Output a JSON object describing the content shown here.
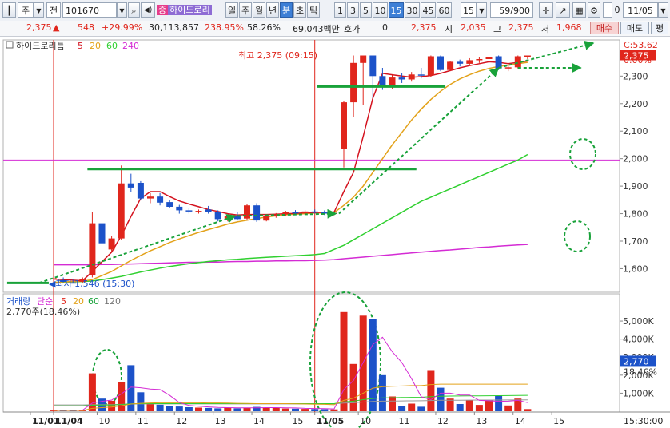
{
  "toolbar": {
    "market": "주",
    "mode": "전",
    "code": "101670",
    "stock_name": "하이드로리",
    "period_tabs": [
      "일",
      "주",
      "월",
      "년",
      "분",
      "초",
      "틱"
    ],
    "active_period": "분",
    "intervals": [
      "1",
      "3",
      "5",
      "10",
      "15",
      "30",
      "45",
      "60"
    ],
    "active_interval": "15",
    "interval_value": "15",
    "count": "59/900",
    "checkbox_label": "0",
    "date": "11/05"
  },
  "quote": {
    "price": "2,375",
    "price_arrow": "▲",
    "change": "548",
    "change_pct": "+29.99%",
    "volume": "30,113,857",
    "volume_ratio": "238.95%",
    "turnover_pct": "58.26%",
    "amount": "69,043백만",
    "quote_label": "호가",
    "quote_value": "0",
    "quote_price": "2,375",
    "open_label": "시",
    "open": "2,035",
    "high_label": "고",
    "high": "2,375",
    "low_label": "저",
    "low": "1,968",
    "buy": "매수",
    "sell": "매도",
    "eval": "평"
  },
  "colors": {
    "up": "#e0261c",
    "down": "#1c52c9",
    "ma5": "#d4131f",
    "ma20": "#e3a21a",
    "ma60": "#30d030",
    "ma240": "#d42bd4",
    "annot": "#19a23a"
  },
  "chart_data": {
    "type": "candlestick",
    "legend": {
      "name": "하이드로리틈",
      "ma": [
        "5",
        "20",
        "60",
        "240"
      ]
    },
    "price_axis": [
      "2,300",
      "2,200",
      "2,100",
      "2,000",
      "1,900",
      "1,800",
      "1,700",
      "1,600"
    ],
    "ylim": [
      1520,
      2420
    ],
    "current_price_label": "2,375",
    "corner_labels": [
      "C:53.62",
      "0.00%"
    ],
    "high_annotation": "최고 2,375 (09:15)",
    "low_annotation": "최저 1,546 (15:30)",
    "reference_line": 1995,
    "time_labels": [
      {
        "label": "11/01",
        "i": -2.4
      },
      {
        "label": "11/04",
        "i": 0
      },
      {
        "label": "10",
        "i": 4.5
      },
      {
        "label": "11",
        "i": 8.5
      },
      {
        "label": "12",
        "i": 12.5
      },
      {
        "label": "13",
        "i": 16.5
      },
      {
        "label": "14",
        "i": 20.5
      },
      {
        "label": "15",
        "i": 24.5
      },
      {
        "label": "11/05",
        "i": 27
      },
      {
        "label": "10",
        "i": 31.5
      },
      {
        "label": "11",
        "i": 35.5
      },
      {
        "label": "12",
        "i": 39.5
      },
      {
        "label": "13",
        "i": 43.5
      },
      {
        "label": "14",
        "i": 47.5
      },
      {
        "label": "15",
        "i": 51.5
      }
    ],
    "candles": [
      {
        "o": 1562,
        "h": 1572,
        "l": 1553,
        "c": 1565
      },
      {
        "o": 1558,
        "h": 1568,
        "l": 1550,
        "c": 1552
      },
      {
        "o": 1550,
        "h": 1560,
        "l": 1546,
        "c": 1548
      },
      {
        "o": 1552,
        "h": 1568,
        "l": 1546,
        "c": 1562
      },
      {
        "o": 1575,
        "h": 1805,
        "l": 1568,
        "c": 1765
      },
      {
        "o": 1765,
        "h": 1790,
        "l": 1675,
        "c": 1692
      },
      {
        "o": 1670,
        "h": 1720,
        "l": 1660,
        "c": 1710
      },
      {
        "o": 1710,
        "h": 1975,
        "l": 1705,
        "c": 1910
      },
      {
        "o": 1910,
        "h": 1945,
        "l": 1878,
        "c": 1895
      },
      {
        "o": 1912,
        "h": 1918,
        "l": 1848,
        "c": 1855
      },
      {
        "o": 1855,
        "h": 1875,
        "l": 1838,
        "c": 1862
      },
      {
        "o": 1862,
        "h": 1875,
        "l": 1830,
        "c": 1840
      },
      {
        "o": 1842,
        "h": 1850,
        "l": 1822,
        "c": 1825
      },
      {
        "o": 1825,
        "h": 1832,
        "l": 1800,
        "c": 1812
      },
      {
        "o": 1812,
        "h": 1820,
        "l": 1800,
        "c": 1808
      },
      {
        "o": 1808,
        "h": 1815,
        "l": 1800,
        "c": 1810
      },
      {
        "o": 1815,
        "h": 1828,
        "l": 1800,
        "c": 1805
      },
      {
        "o": 1805,
        "h": 1812,
        "l": 1772,
        "c": 1780
      },
      {
        "o": 1780,
        "h": 1792,
        "l": 1772,
        "c": 1790
      },
      {
        "o": 1790,
        "h": 1805,
        "l": 1775,
        "c": 1780
      },
      {
        "o": 1782,
        "h": 1835,
        "l": 1775,
        "c": 1830
      },
      {
        "o": 1830,
        "h": 1838,
        "l": 1770,
        "c": 1775
      },
      {
        "o": 1775,
        "h": 1795,
        "l": 1772,
        "c": 1792
      },
      {
        "o": 1792,
        "h": 1802,
        "l": 1785,
        "c": 1797
      },
      {
        "o": 1797,
        "h": 1810,
        "l": 1790,
        "c": 1806
      },
      {
        "o": 1806,
        "h": 1813,
        "l": 1798,
        "c": 1801
      },
      {
        "o": 1801,
        "h": 1813,
        "l": 1795,
        "c": 1808
      },
      {
        "o": 1808,
        "h": 1815,
        "l": 1800,
        "c": 1805
      },
      {
        "o": 1805,
        "h": 1812,
        "l": 1795,
        "c": 1800
      },
      {
        "o": 1800,
        "h": 1810,
        "l": 1794,
        "c": 1803
      },
      {
        "o": 2035,
        "h": 2210,
        "l": 1968,
        "c": 2205
      },
      {
        "o": 2205,
        "h": 2375,
        "l": 2150,
        "c": 2348
      },
      {
        "o": 2348,
        "h": 2375,
        "l": 2195,
        "c": 2375
      },
      {
        "o": 2375,
        "h": 2375,
        "l": 2220,
        "c": 2300
      },
      {
        "o": 2300,
        "h": 2330,
        "l": 2250,
        "c": 2260
      },
      {
        "o": 2260,
        "h": 2305,
        "l": 2255,
        "c": 2295
      },
      {
        "o": 2295,
        "h": 2310,
        "l": 2275,
        "c": 2288
      },
      {
        "o": 2288,
        "h": 2315,
        "l": 2280,
        "c": 2306
      },
      {
        "o": 2306,
        "h": 2330,
        "l": 2292,
        "c": 2302
      },
      {
        "o": 2302,
        "h": 2375,
        "l": 2298,
        "c": 2372
      },
      {
        "o": 2372,
        "h": 2375,
        "l": 2318,
        "c": 2322
      },
      {
        "o": 2322,
        "h": 2355,
        "l": 2318,
        "c": 2352
      },
      {
        "o": 2352,
        "h": 2360,
        "l": 2335,
        "c": 2345
      },
      {
        "o": 2345,
        "h": 2365,
        "l": 2340,
        "c": 2358
      },
      {
        "o": 2358,
        "h": 2370,
        "l": 2348,
        "c": 2362
      },
      {
        "o": 2362,
        "h": 2375,
        "l": 2352,
        "c": 2370
      },
      {
        "o": 2372,
        "h": 2375,
        "l": 2322,
        "c": 2328
      },
      {
        "o": 2328,
        "h": 2340,
        "l": 2318,
        "c": 2332
      },
      {
        "o": 2332,
        "h": 2375,
        "l": 2328,
        "c": 2372
      },
      {
        "o": 2372,
        "h": 2375,
        "l": 2362,
        "c": 2375
      }
    ],
    "ma5": [
      1562,
      1560,
      1558,
      1556,
      1590,
      1625,
      1660,
      1720,
      1790,
      1855,
      1880,
      1880,
      1862,
      1846,
      1835,
      1825,
      1815,
      1808,
      1800,
      1795,
      1797,
      1797,
      1797,
      1798,
      1800,
      1801,
      1803,
      1804,
      1805,
      1805,
      1880,
      1950,
      2080,
      2220,
      2310,
      2305,
      2300,
      2296,
      2298,
      2302,
      2310,
      2320,
      2330,
      2338,
      2345,
      2352,
      2350,
      2345,
      2350,
      2355
    ],
    "ma20": [
      1550,
      1552,
      1553,
      1554,
      1560,
      1575,
      1590,
      1610,
      1630,
      1648,
      1665,
      1680,
      1695,
      1708,
      1720,
      1732,
      1742,
      1752,
      1762,
      1770,
      1776,
      1782,
      1788,
      1792,
      1796,
      1798,
      1800,
      1802,
      1803,
      1804,
      1830,
      1860,
      1900,
      1950,
      2000,
      2050,
      2095,
      2140,
      2180,
      2215,
      2245,
      2270,
      2290,
      2305,
      2318,
      2328,
      2335,
      2340,
      2345,
      2350
    ],
    "ma60": [
      1550,
      1551,
      1552,
      1553,
      1555,
      1560,
      1566,
      1572,
      1580,
      1588,
      1595,
      1602,
      1608,
      1613,
      1618,
      1622,
      1626,
      1629,
      1632,
      1634,
      1637,
      1639,
      1641,
      1643,
      1645,
      1647,
      1649,
      1651,
      1655,
      1670,
      1685,
      1705,
      1725,
      1745,
      1765,
      1785,
      1805,
      1825,
      1845,
      1860,
      1875,
      1890,
      1905,
      1920,
      1935,
      1950,
      1965,
      1980,
      1995,
      2015
    ],
    "ma240": [
      1614,
      1614,
      1614,
      1614,
      1614,
      1615,
      1615,
      1616,
      1617,
      1618,
      1619,
      1620,
      1621,
      1622,
      1623,
      1623,
      1624,
      1624,
      1625,
      1626,
      1626,
      1627,
      1627,
      1628,
      1628,
      1629,
      1629,
      1630,
      1631,
      1633,
      1636,
      1639,
      1642,
      1645,
      1648,
      1651,
      1654,
      1657,
      1660,
      1663,
      1666,
      1668,
      1671,
      1674,
      1677,
      1679,
      1682,
      1684,
      1686,
      1688
    ],
    "volume_legend": {
      "name": "거래량",
      "type": "단순",
      "ma": [
        "5",
        "20",
        "60",
        "120"
      ],
      "current": "2,770주(18.46%)"
    },
    "volume_axis": [
      "5,000K",
      "4,000K",
      "3,000K",
      "2,000K",
      "1,000K"
    ],
    "volume_ylim": [
      0,
      5800
    ],
    "volume_value_label": "2,770",
    "volume_pct_label": "18.46%",
    "last_time": "15:30:00",
    "volume": [
      40,
      60,
      50,
      40,
      2100,
      700,
      580,
      1600,
      2550,
      1050,
      420,
      360,
      300,
      260,
      220,
      200,
      180,
      160,
      200,
      160,
      200,
      240,
      180,
      200,
      150,
      140,
      130,
      120,
      110,
      100,
      5500,
      2620,
      5300,
      5100,
      2000,
      820,
      300,
      420,
      250,
      2280,
      1300,
      700,
      400,
      620,
      350,
      600,
      860,
      320,
      700,
      120
    ],
    "vol_ma5": [
      60,
      60,
      60,
      60,
      450,
      550,
      620,
      960,
      1340,
      1300,
      1230,
      1200,
      880,
      480,
      320,
      280,
      240,
      210,
      200,
      190,
      190,
      190,
      200,
      200,
      190,
      180,
      160,
      150,
      140,
      130,
      1200,
      1700,
      2700,
      3700,
      4100,
      3300,
      2700,
      1800,
      800,
      640,
      1000,
      1000,
      900,
      900,
      600,
      580,
      550,
      560,
      600,
      480
    ],
    "vol_ma20": [
      40,
      40,
      40,
      40,
      160,
      200,
      230,
      300,
      400,
      440,
      460,
      470,
      470,
      470,
      470,
      470,
      460,
      460,
      450,
      440,
      430,
      420,
      420,
      420,
      420,
      410,
      400,
      390,
      380,
      360,
      600,
      720,
      1000,
      1280,
      1360,
      1380,
      1400,
      1420,
      1420,
      1480,
      1500,
      1500,
      1500,
      1500,
      1500,
      1500,
      1500,
      1500,
      1500,
      1500
    ],
    "vol_ma60": [
      300,
      300,
      300,
      300,
      330,
      340,
      345,
      370,
      410,
      420,
      420,
      420,
      420,
      420,
      420,
      420,
      420,
      420,
      420,
      420,
      420,
      420,
      420,
      420,
      420,
      420,
      420,
      420,
      420,
      420,
      520,
      560,
      640,
      710,
      740,
      750,
      760,
      770,
      775,
      810,
      830,
      840,
      845,
      850,
      855,
      860,
      865,
      870,
      875,
      880
    ],
    "vol_ma120": [
      350,
      350,
      350,
      350,
      360,
      365,
      368,
      380,
      400,
      405,
      405,
      405,
      405,
      405,
      405,
      405,
      405,
      405,
      405,
      405,
      405,
      405,
      405,
      405,
      405,
      405,
      405,
      405,
      405,
      405,
      450,
      470,
      510,
      545,
      560,
      565,
      570,
      575,
      578,
      595,
      605,
      610,
      612,
      615,
      618,
      620,
      622,
      624,
      626,
      628
    ]
  }
}
